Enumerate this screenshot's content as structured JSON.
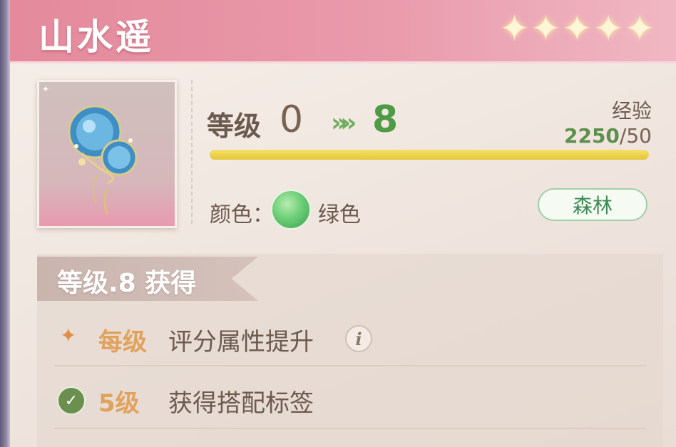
{
  "header": {
    "title": "山水遥",
    "stars": 5,
    "star_glyph": "✦"
  },
  "item": {
    "icon": "blue-flower-charm-icon",
    "border_color": "#f7efe9"
  },
  "level": {
    "label": "等级",
    "from": "0",
    "arrow_glyph": "»",
    "to": "8"
  },
  "experience": {
    "label": "经验",
    "current": "2250",
    "separator": "/",
    "max": "50",
    "fill_fraction": 1.0
  },
  "color": {
    "label": "颜色：",
    "name": "绿色",
    "swatch_hex": "#6ccf77"
  },
  "tag": {
    "label": "森林"
  },
  "rewards": {
    "title": "等级.8 获得",
    "rows": [
      {
        "icon": "sparkle-icon",
        "glyph": "✦",
        "level": "每级",
        "text": "评分属性提升",
        "info": "i"
      },
      {
        "icon": "check-icon",
        "glyph": "✓",
        "level": "5级",
        "text": "获得搭配标签"
      }
    ]
  },
  "colors": {
    "header_pink": "#e48a9c",
    "level_green": "#4f9a44",
    "reward_orange": "#e0a25c",
    "text_brown": "#6b5a4f"
  }
}
